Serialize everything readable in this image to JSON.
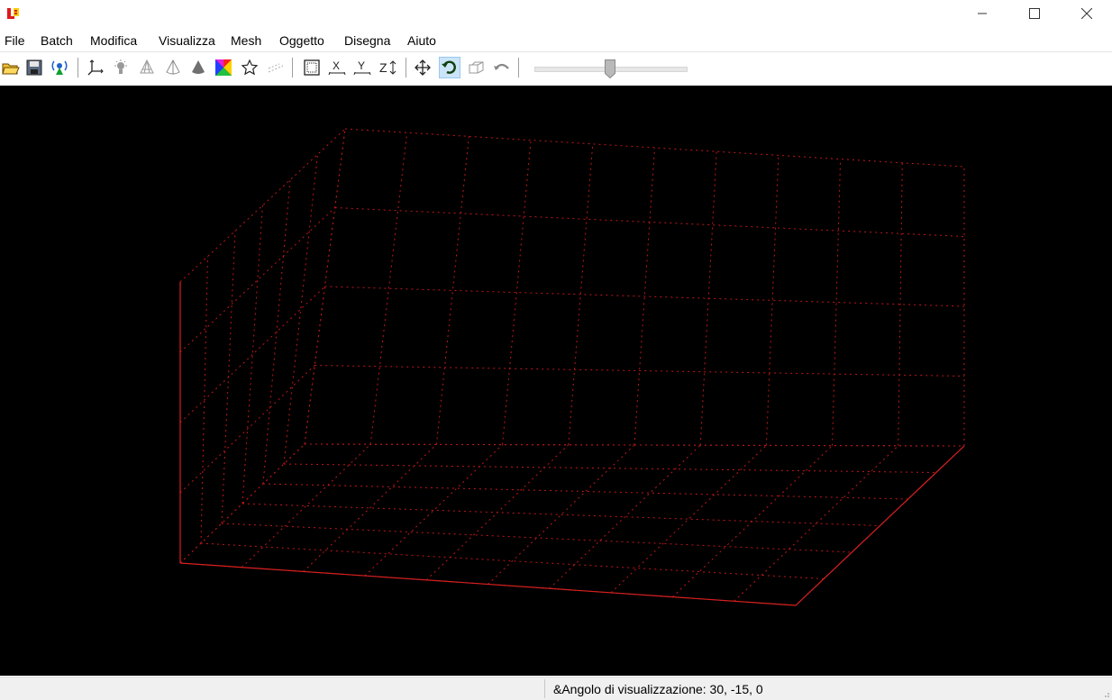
{
  "window": {
    "app_icon": "lb-app-icon",
    "controls": [
      {
        "name": "minimize-button",
        "icon": "minimize-icon"
      },
      {
        "name": "maximize-button",
        "icon": "maximize-icon"
      },
      {
        "name": "close-button",
        "icon": "close-icon"
      }
    ]
  },
  "menu": [
    "File",
    "Batch",
    "Modifica",
    "Visualizza",
    "Mesh",
    "Oggetto",
    "Disegna",
    "Aiuto"
  ],
  "toolbar": {
    "buttons": [
      "open-folder-icon",
      "save-icon",
      "network-icon",
      "axes-icon",
      "light-icon",
      "wireframe-cone-icon",
      "outline-cone-icon",
      "solid-cone-icon",
      "color-palette-icon",
      "star-icon",
      "points-icon",
      "frame-icon",
      "x-axis-icon",
      "y-axis-icon",
      "z-axis-icon",
      "move-icon",
      "rotate-icon",
      "zoom-object-icon",
      "undo-icon"
    ],
    "active": "rotate-icon",
    "slider_value": 0.5
  },
  "viewport": {
    "background": "#000000",
    "grid_color": "#c01818",
    "axis_color": "#d82020"
  },
  "status": {
    "text": "&Angolo di visualizzazione: 30, -15, 0"
  }
}
